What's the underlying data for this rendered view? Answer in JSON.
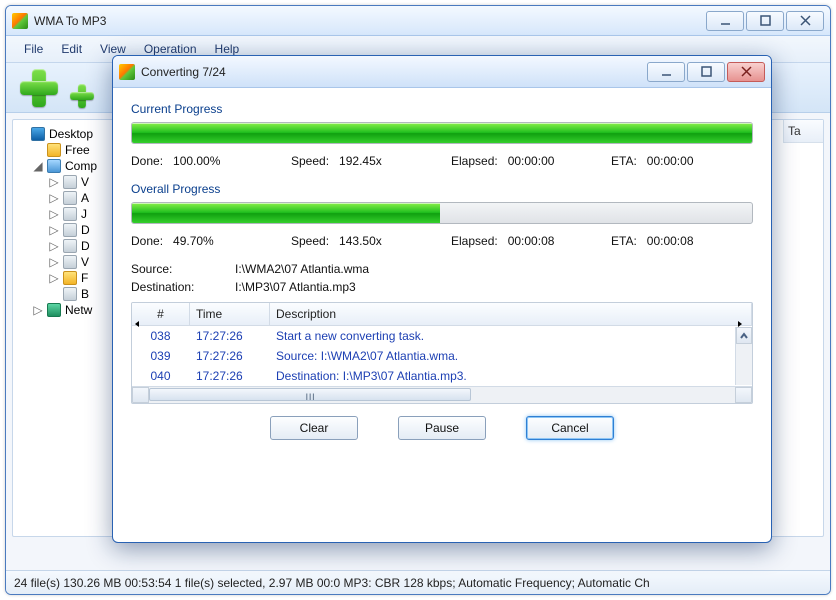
{
  "main": {
    "title": "WMA To MP3",
    "menu": [
      "File",
      "Edit",
      "View",
      "Operation",
      "Help"
    ],
    "tree": [
      {
        "indent": 0,
        "toggle": "",
        "icon": "ic-desktop",
        "label": "Desktop"
      },
      {
        "indent": 1,
        "toggle": "",
        "icon": "ic-folder",
        "label": "Free"
      },
      {
        "indent": 1,
        "toggle": "◢",
        "icon": "ic-computer",
        "label": "Comp"
      },
      {
        "indent": 2,
        "toggle": "▷",
        "icon": "ic-drive",
        "label": "V"
      },
      {
        "indent": 2,
        "toggle": "▷",
        "icon": "ic-drive",
        "label": "A"
      },
      {
        "indent": 2,
        "toggle": "▷",
        "icon": "ic-drive",
        "label": "J"
      },
      {
        "indent": 2,
        "toggle": "▷",
        "icon": "ic-drive",
        "label": "D"
      },
      {
        "indent": 2,
        "toggle": "▷",
        "icon": "ic-drive",
        "label": "D"
      },
      {
        "indent": 2,
        "toggle": "▷",
        "icon": "ic-drive",
        "label": "V"
      },
      {
        "indent": 2,
        "toggle": "▷",
        "icon": "ic-folder",
        "label": "F"
      },
      {
        "indent": 2,
        "toggle": "",
        "icon": "ic-drive",
        "label": "B"
      },
      {
        "indent": 1,
        "toggle": "▷",
        "icon": "ic-network",
        "label": "Netw"
      }
    ],
    "right_col_header": "Ta",
    "statusbar": "24 file(s)   130.26 MB   00:53:54   1 file(s) selected, 2.97 MB   00:0    MP3:  CBR 128 kbps; Automatic Frequency; Automatic Ch"
  },
  "dialog": {
    "title": "Converting 7/24",
    "sections": {
      "current": {
        "heading": "Current Progress",
        "percent": 100.0,
        "stats": {
          "done_label": "Done:",
          "done_value": "100.00%",
          "speed_label": "Speed:",
          "speed_value": "192.45x",
          "elapsed_label": "Elapsed:",
          "elapsed_value": "00:00:00",
          "eta_label": "ETA:",
          "eta_value": "00:00:00"
        }
      },
      "overall": {
        "heading": "Overall Progress",
        "percent": 49.7,
        "stats": {
          "done_label": "Done:",
          "done_value": "49.70%",
          "speed_label": "Speed:",
          "speed_value": "143.50x",
          "elapsed_label": "Elapsed:",
          "elapsed_value": "00:00:08",
          "eta_label": "ETA:",
          "eta_value": "00:00:08"
        }
      }
    },
    "source_label": "Source:",
    "source_value": "I:\\WMA2\\07 Atlantia.wma",
    "dest_label": "Destination:",
    "dest_value": "I:\\MP3\\07 Atlantia.mp3",
    "log": {
      "headers": {
        "n": "#",
        "t": "Time",
        "d": "Description"
      },
      "rows": [
        {
          "n": "038",
          "t": "17:27:26",
          "d": "Start a new converting task."
        },
        {
          "n": "039",
          "t": "17:27:26",
          "d": "Source:  I:\\WMA2\\07 Atlantia.wma."
        },
        {
          "n": "040",
          "t": "17:27:26",
          "d": "Destination: I:\\MP3\\07 Atlantia.mp3."
        }
      ],
      "h_scrub_marker": "ııı"
    },
    "buttons": {
      "clear": "Clear",
      "pause": "Pause",
      "cancel": "Cancel"
    }
  }
}
